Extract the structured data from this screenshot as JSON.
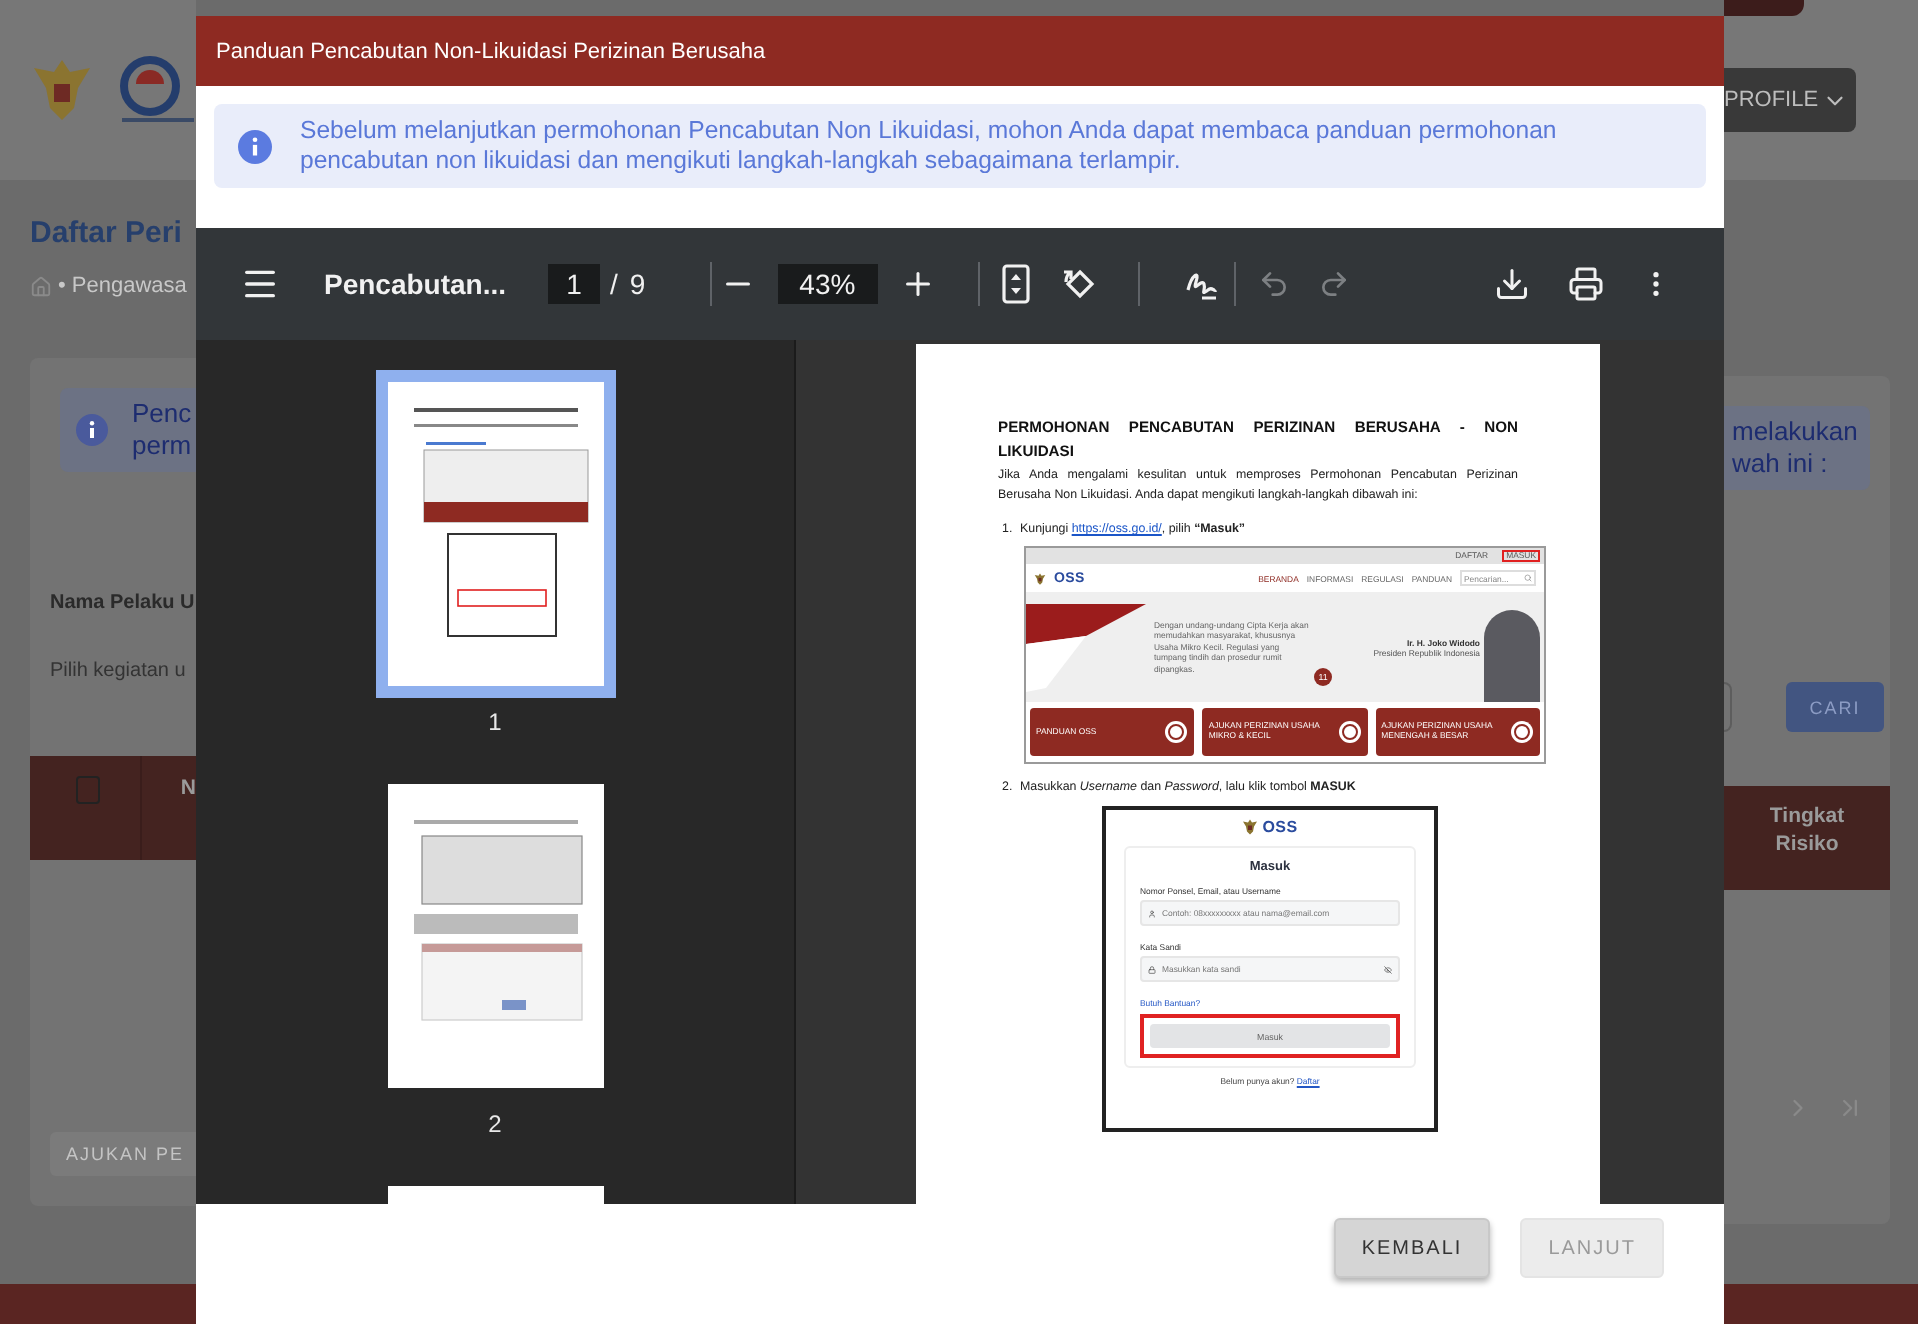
{
  "background": {
    "profile_button": "PROFILE",
    "page_title": "Daftar Peri",
    "breadcrumb": "• Pengawasa",
    "notice_left": [
      "Penc",
      "perm"
    ],
    "select_all_checked": false,
    "notice_right": [
      "melakukan",
      "wah ini :"
    ],
    "field_label": "Nama Pelaku U",
    "field_hint": "Pilih kegiatan u",
    "search_button": "CARI",
    "table_columns": [
      "N",
      "Tingkat Risiko"
    ],
    "submit_button": "AJUKAN PE"
  },
  "dialog": {
    "title": "Panduan Pencabutan Non-Likuidasi Perizinan Berusaha",
    "notice": "Sebelum melanjutkan permohonan Pencabutan Non Likuidasi, mohon Anda dapat membaca panduan permohonan pencabutan non likuidasi dan mengikuti langkah-langkah sebagaimana terlampir.",
    "viewer": {
      "file_title": "Pencabutan...",
      "page": "1",
      "page_separator": "/",
      "page_count": "9",
      "zoom": "43%",
      "thumbnails": [
        {
          "label": "1",
          "selected": true
        },
        {
          "label": "2",
          "selected": false
        },
        {
          "selected": false
        }
      ],
      "document": {
        "heading": "PERMOHONAN PENCABUTAN PERIZINAN BERUSAHA - NON LIKUIDASI",
        "intro": "Jika Anda mengalami kesulitan untuk memproses Permohonan Pencabutan Perizinan Berusaha Non Likuidasi.  Anda dapat mengikuti langkah-langkah dibawah ini:",
        "steps": [
          {
            "kind": "website",
            "number": "1.",
            "text": "Kunjungi",
            "link": "https://oss.go.id/",
            "after": ", pilih **“Masuk”**",
            "screenshot": {
              "top_links": [
                {
                  "label": "DAFTAR",
                  "highlighted": false
                },
                {
                  "label": "MASUK",
                  "highlighted": true
                }
              ],
              "logo": "OSS",
              "nav": [
                "BERANDA",
                "INFORMASI",
                "REGULASI",
                "PANDUAN"
              ],
              "search_placeholder": "Pencarian...",
              "hero_text": "Dengan undang-undang Cipta Kerja akan memudahkan masyarakat, khususnya Usaha Mikro Kecil. Regulasi yang tumpang tindih dan prosedur rumit dipangkas.",
              "badge": "11",
              "person_name": "Ir. H. Joko Widodo",
              "person_title": "Presiden Republik Indonesia",
              "cards": [
                "PANDUAN OSS",
                "AJUKAN PERIZINAN USAHA MIKRO & KECIL",
                "AJUKAN PERIZINAN USAHA MENENGAH & BESAR"
              ]
            }
          },
          {
            "kind": "login",
            "number": "2.",
            "text": "Masukkan *Username* dan *Password*, lalu klik tombol **MASUK**",
            "screenshot": {
              "logo": "OSS",
              "title": "Masuk",
              "fields": [
                {
                  "label": "Nomor Ponsel, Email, atau Username",
                  "placeholder": "Contoh: 08xxxxxxxxx atau nama@email.com"
                },
                {
                  "label": "Kata Sandi",
                  "placeholder": "Masukkan kata sandi"
                }
              ],
              "help_link": "Butuh Bantuan?",
              "submit": "Masuk",
              "submit_highlighted": true,
              "signup_prompt": "Belum punya akun?",
              "signup_link": "Daftar"
            }
          }
        ]
      }
    },
    "buttons": [
      {
        "label": "KEMBALI",
        "disabled": false
      },
      {
        "label": "LANJUT",
        "disabled": true
      }
    ]
  }
}
